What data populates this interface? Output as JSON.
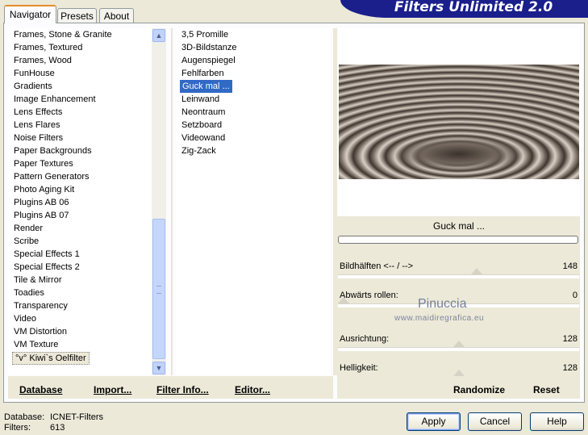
{
  "app": {
    "title": "Filters Unlimited 2.0"
  },
  "tabs": [
    {
      "label": "Navigator",
      "active": true
    },
    {
      "label": "Presets",
      "active": false
    },
    {
      "label": "About",
      "active": false
    }
  ],
  "categories": {
    "items": [
      "Frames, Stone & Granite",
      "Frames, Textured",
      "Frames, Wood",
      "FunHouse",
      "Gradients",
      "Image Enhancement",
      "Lens Effects",
      "Lens Flares",
      "Noise Filters",
      "Paper Backgrounds",
      "Paper Textures",
      "Pattern Generators",
      "Photo Aging Kit",
      "Plugins AB 06",
      "Plugins AB 07",
      "Render",
      "Scribe",
      "Special Effects 1",
      "Special Effects 2",
      "Tile & Mirror",
      "Toadies",
      "Transparency",
      "Video",
      "VM Distortion",
      "VM Texture",
      "°v° Kiwi`s Oelfilter"
    ],
    "selected_index": 25
  },
  "filters": {
    "items": [
      "3,5 Promille",
      "3D-Bildstanze",
      "Augenspiegel",
      "Fehlfarben",
      "Guck mal ...",
      "Leinwand",
      "Neontraum",
      "Setzboard",
      "Videowand",
      "Zig-Zack"
    ],
    "selected_index": 4
  },
  "preview": {
    "filter_name": "Guck mal ..."
  },
  "sliders": [
    {
      "label": "Bildhälften <-- / -->",
      "value": "148",
      "level": 148
    },
    {
      "label": "Abwärts rollen:",
      "value": "0",
      "level": 0
    },
    {
      "label": "Ausrichtung:",
      "value": "128",
      "level": 128
    },
    {
      "label": "Helligkeit:",
      "value": "128",
      "level": 128
    }
  ],
  "watermark": {
    "name": "Pinuccia",
    "site": "www.maidiregrafica.eu"
  },
  "toolbar": {
    "database": "Database",
    "import": "Import...",
    "filter_info": "Filter Info...",
    "editor": "Editor...",
    "randomize": "Randomize",
    "reset": "Reset"
  },
  "status": {
    "database_label": "Database:",
    "database_value": "ICNET-Filters",
    "filters_label": "Filters:",
    "filters_value": "613"
  },
  "buttons": {
    "apply": "Apply",
    "cancel": "Cancel",
    "help": "Help"
  }
}
